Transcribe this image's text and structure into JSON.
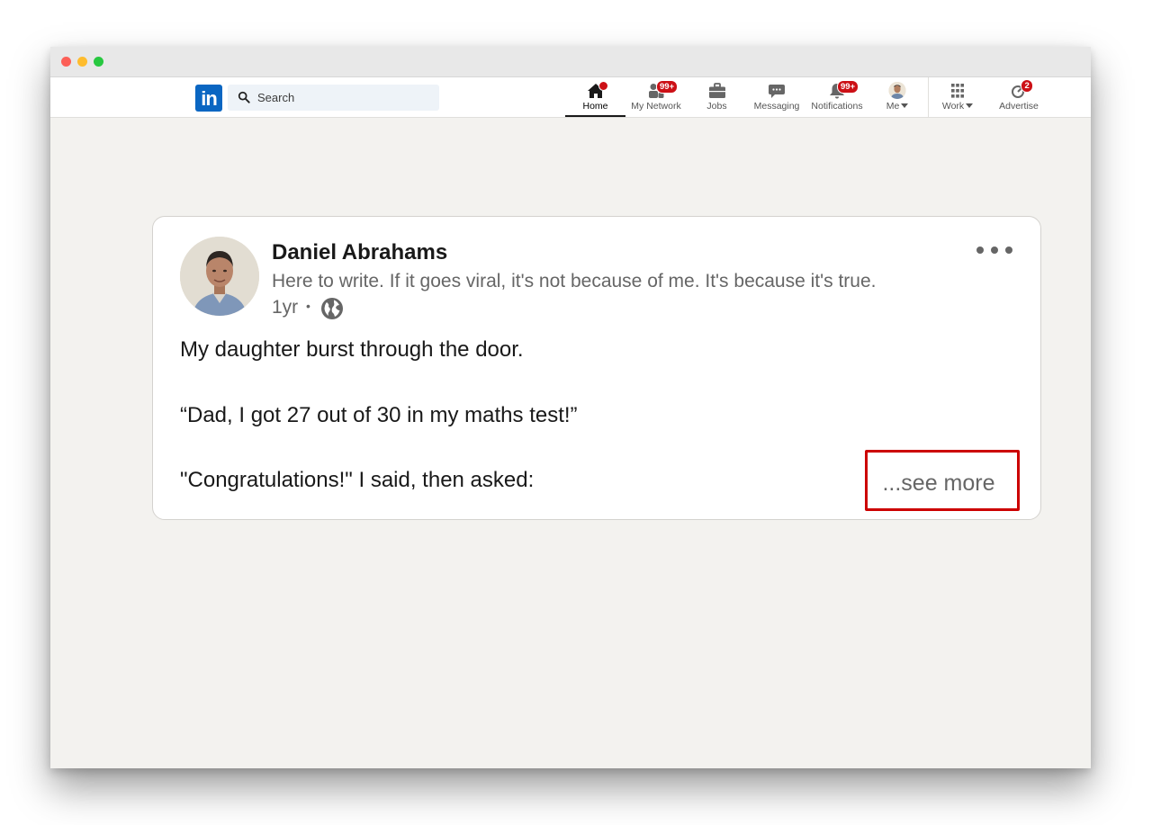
{
  "window": {
    "traffic_lights": [
      "close",
      "minimize",
      "zoom"
    ]
  },
  "navbar": {
    "logo_text": "in",
    "search": {
      "placeholder": "Search"
    },
    "items": [
      {
        "label": "Home",
        "icon": "home-icon",
        "active": true,
        "badge": ""
      },
      {
        "label": "My Network",
        "icon": "network-icon",
        "active": false,
        "badge": "99+"
      },
      {
        "label": "Jobs",
        "icon": "briefcase-icon",
        "active": false,
        "badge": ""
      },
      {
        "label": "Messaging",
        "icon": "chat-icon",
        "active": false,
        "badge": ""
      },
      {
        "label": "Notifications",
        "icon": "bell-icon",
        "active": false,
        "badge": "99+"
      },
      {
        "label": "Me",
        "icon": "avatar",
        "active": false,
        "badge": ""
      },
      {
        "label": "Work",
        "icon": "grid-icon",
        "active": false,
        "badge": ""
      },
      {
        "label": "Advertise",
        "icon": "advertise-icon",
        "active": false,
        "badge": "2"
      }
    ]
  },
  "post": {
    "author_name": "Daniel Abrahams",
    "headline": "Here to write. If it goes viral, it's not because of me. It's because it's true.",
    "time": "1yr",
    "separator": "•",
    "visibility_icon": "globe-icon",
    "lines": [
      "My daughter burst through the door.",
      "“Dad, I got 27 out of 30 in my maths test!”",
      "\"Congratulations!\" I said, then asked:"
    ],
    "see_more_label": "...see more"
  },
  "colors": {
    "brand": "#0a66c2",
    "badge": "#cc1016",
    "highlight_border": "#cc0000",
    "page_background": "#f3f2ef"
  }
}
